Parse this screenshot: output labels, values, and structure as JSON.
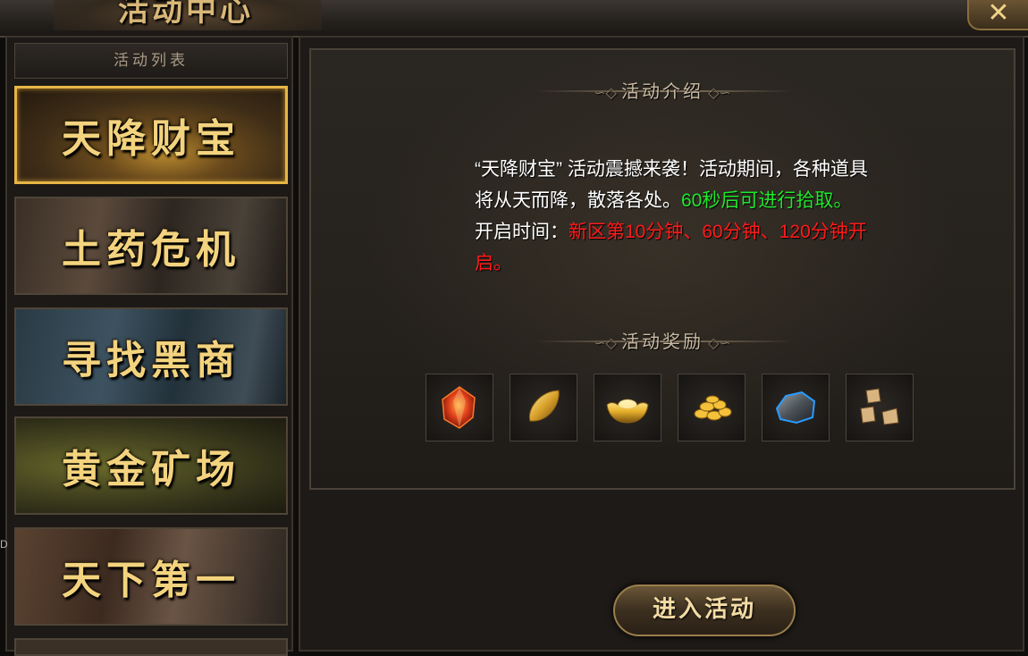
{
  "window": {
    "title": "活动中心",
    "close_icon": "close-x-icon"
  },
  "sidebar": {
    "header": "活动列表",
    "items": [
      {
        "label": "天降财宝",
        "selected": true
      },
      {
        "label": "土药危机",
        "selected": false
      },
      {
        "label": "寻找黑商",
        "selected": false
      },
      {
        "label": "黄金矿场",
        "selected": false
      },
      {
        "label": "天下第一",
        "selected": false
      },
      {
        "label": "",
        "selected": false
      }
    ]
  },
  "main": {
    "intro_title": "活动介绍",
    "description": {
      "part1": "“天降财宝” 活动震撼来袭！活动期间，各种道具将从天而降，散落各处。",
      "part1_green": "60秒后可进行拾取。",
      "time_label": "开启时间：",
      "time_value": "新区第10分钟、60分钟、120分钟开启。"
    },
    "rewards_title": "活动奖励",
    "rewards": [
      {
        "icon": "red-gem-icon"
      },
      {
        "icon": "gold-shard-icon"
      },
      {
        "icon": "gold-ingot-icon"
      },
      {
        "icon": "gold-coins-icon"
      },
      {
        "icon": "iron-ore-icon"
      },
      {
        "icon": "broken-stone-icon"
      }
    ],
    "enter_button": "进入活动"
  },
  "edge_text": "D",
  "colors": {
    "highlight_green": "#1fe82b",
    "highlight_red": "#ff1a1a",
    "gold_text": "#f3d37e",
    "selected_border": "#e7b545"
  }
}
